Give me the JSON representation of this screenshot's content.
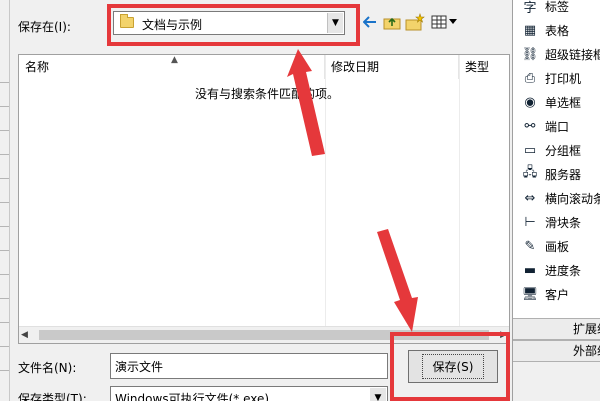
{
  "dialog": {
    "save_in_label": "保存在(I):",
    "location": "文档与示例",
    "columns": {
      "name": "名称",
      "date_modified": "修改日期",
      "type": "类型"
    },
    "empty_message": "没有与搜索条件匹配的项。",
    "filename_label": "文件名(N):",
    "filename_value": "演示文件",
    "filetype_label": "保存类型(T):",
    "filetype_value": "Windows可执行文件(*.exe)",
    "save_button": "保存(S)"
  },
  "toolbar_icons": [
    "back-icon",
    "up-folder-icon",
    "new-folder-icon",
    "view-menu-icon"
  ],
  "toolbox": {
    "items": [
      {
        "icon": "字",
        "label": "标签"
      },
      {
        "icon": "▦",
        "label": "表格"
      },
      {
        "icon": "⛓",
        "label": "超级链接框"
      },
      {
        "icon": "⎙",
        "label": "打印机"
      },
      {
        "icon": "◉",
        "label": "单选框"
      },
      {
        "icon": "⚯",
        "label": "端口"
      },
      {
        "icon": "▭",
        "label": "分组框"
      },
      {
        "icon": "🖧",
        "label": "服务器"
      },
      {
        "icon": "⇔",
        "label": "横向滚动条"
      },
      {
        "icon": "⊢",
        "label": "滑块条"
      },
      {
        "icon": "✎",
        "label": "画板"
      },
      {
        "icon": "▬",
        "label": "进度条"
      },
      {
        "icon": "🖥",
        "label": "客户"
      }
    ],
    "tabs": [
      "扩展组件",
      "外部组件"
    ]
  },
  "colors": {
    "highlight": "#e5383b",
    "folder": "#f3d36b",
    "dialog_bg": "#f0f0f0"
  }
}
